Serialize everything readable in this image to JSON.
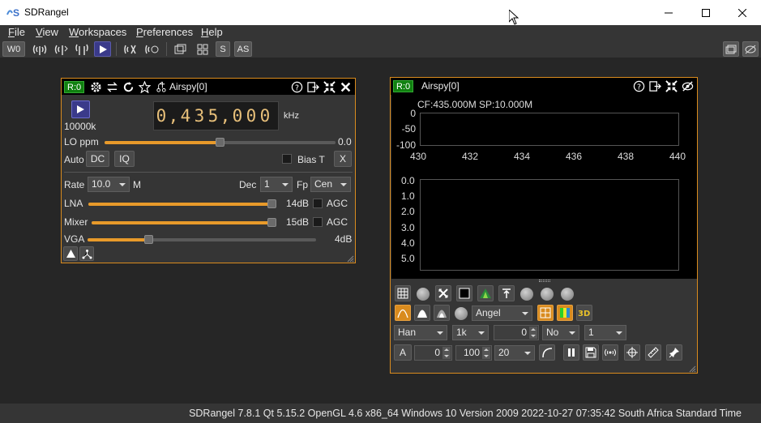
{
  "window": {
    "title": "SDRangel"
  },
  "menu": [
    "File",
    "View",
    "Workspaces",
    "Preferences",
    "Help"
  ],
  "toolbar": {
    "workspace": "W0",
    "s": "S",
    "as": "AS"
  },
  "rx_panel": {
    "badge": "R:0",
    "title": "Airspy[0]",
    "sample_rate": "10000k",
    "frequency_digits": [
      "0",
      ",",
      "4",
      "3",
      "5",
      ",",
      "0",
      "0",
      "0"
    ],
    "frequency_unit": "kHz",
    "lo_ppm_label": "LO ppm",
    "lo_ppm_value": "0.0",
    "auto_label": "Auto",
    "dc_label": "DC",
    "iq_label": "IQ",
    "bias_label": "Bias T",
    "x_label": "X",
    "rate_label": "Rate",
    "rate_value": "10.0",
    "rate_unit": "M",
    "dec_label": "Dec",
    "dec_value": "1",
    "fp_label": "Fp",
    "fp_value": "Cen",
    "lna_label": "LNA",
    "lna_value": "14dB",
    "lna_level": 1.0,
    "mixer_label": "Mixer",
    "mixer_value": "15dB",
    "mixer_level": 1.0,
    "vga_label": "VGA",
    "vga_value": "4dB",
    "vga_level": 0.27,
    "lo_level": 0.5,
    "agc_label": "AGC"
  },
  "spectrum_panel": {
    "badge": "R:0",
    "title": "Airspy[0]",
    "cf_sp": "CF:435.000M SP:10.000M",
    "y_ticks": [
      "0",
      "-50",
      "-100"
    ],
    "x_ticks": [
      "430",
      "432",
      "434",
      "436",
      "438",
      "440"
    ],
    "wf_ticks": [
      "0.0",
      "1.0",
      "2.0",
      "3.0",
      "4.0",
      "5.0"
    ],
    "palette": "Angel",
    "window_fn": "Han",
    "fft_size": "1k",
    "overlap": "0",
    "averaging": "No",
    "avg_count": "1",
    "a_label": "A",
    "ref_level": "0",
    "range": "100",
    "fps": "20"
  },
  "status": "SDRangel 7.8.1 Qt 5.15.2 OpenGL 4.6 x86_64 Windows 10 Version 2009  2022-10-27 07:35:42 South Africa Standard Time",
  "colors": {
    "accent": "#d98b1e",
    "badge": "#108010",
    "digits": "#e8c07a"
  }
}
